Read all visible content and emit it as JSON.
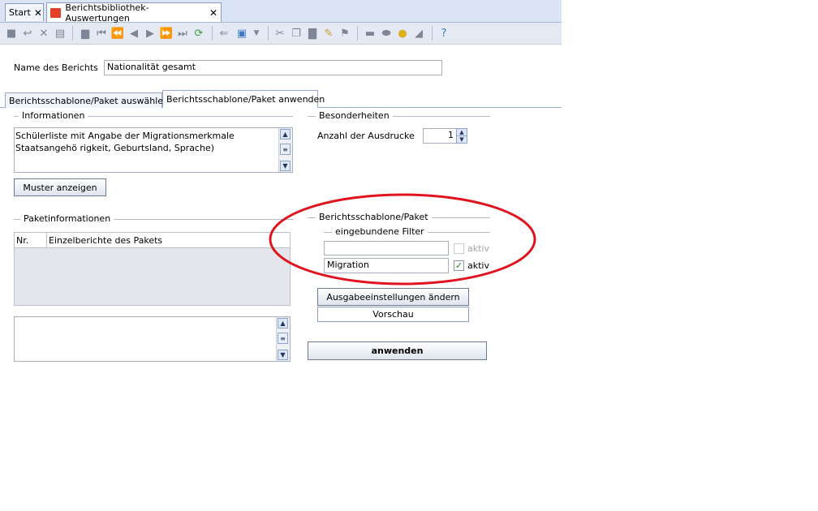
{
  "tabs": [
    {
      "label": "Start"
    },
    {
      "label": "Berichtsbibliothek-Auswertungen"
    }
  ],
  "toolbar_icons": [
    "save-icon",
    "undo-icon",
    "delete-icon",
    "report-icon",
    "folder-icon",
    "first-record-icon",
    "previous-page-icon",
    "previous-record-icon",
    "next-record-icon",
    "next-page-icon",
    "last-record-icon",
    "refresh-icon",
    "back-arrow-icon",
    "new-document-icon",
    "dropdown-arrow-icon",
    "cut-icon",
    "copy-icon",
    "paste-icon",
    "edit-icon",
    "format-painter-icon",
    "print-icon",
    "preview-icon",
    "lightbulb-icon",
    "eraser-icon",
    "help-icon"
  ],
  "report_name": {
    "label": "Name des Berichts",
    "value": "Nationalität gesamt"
  },
  "subtabs": [
    {
      "label": "Berichtsschablone/Paket auswählen"
    },
    {
      "label": "Berichtsschablone/Paket anwenden"
    }
  ],
  "informationen": {
    "title": "Informationen",
    "text": "Schülerliste mit Angabe der Migrationsmerkmale Staatsangehö rigkeit, Geburtsland, Sprache)",
    "muster_button": "Muster anzeigen"
  },
  "besonderheiten": {
    "title": "Besonderheiten",
    "ausdrucke_label": "Anzahl der Ausdrucke",
    "ausdrucke_value": "1"
  },
  "paketinformationen": {
    "title": "Paketinformationen",
    "col_nr": "Nr.",
    "col_einzelberichte": "Einzelberichte des Pakets"
  },
  "berichtsschablone": {
    "title": "Berichtsschablone/Paket",
    "filter_title": "eingebundene Filter",
    "filters": [
      {
        "value": "",
        "aktiv_label": "aktiv",
        "checked": false
      },
      {
        "value": "Migration",
        "aktiv_label": "aktiv",
        "checked": true
      }
    ],
    "ausgabe_button": "Ausgabeeinstellungen ändern",
    "vorschau_button": "Vorschau",
    "anwenden_button": "anwenden"
  },
  "colors": {
    "highlight_ellipse": "#e0141e",
    "tabbar": "#dbe4f5"
  }
}
